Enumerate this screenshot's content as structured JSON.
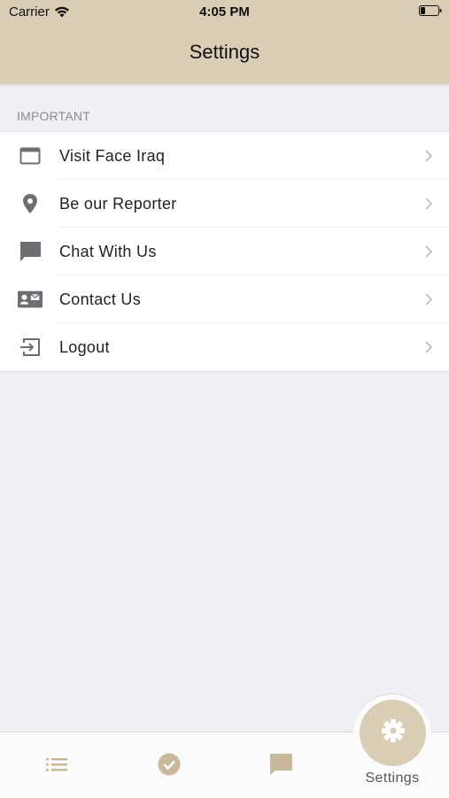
{
  "status_bar": {
    "carrier": "Carrier",
    "time": "4:05 PM"
  },
  "header": {
    "title": "Settings"
  },
  "section": {
    "title": "IMPORTANT"
  },
  "menu": {
    "items": [
      {
        "label": "Visit Face Iraq",
        "icon": "browser-window-icon"
      },
      {
        "label": "Be our Reporter",
        "icon": "location-pin-icon"
      },
      {
        "label": "Chat With Us",
        "icon": "chat-bubble-icon"
      },
      {
        "label": "Contact Us",
        "icon": "contact-card-icon"
      },
      {
        "label": "Logout",
        "icon": "logout-icon"
      }
    ]
  },
  "tabbar": {
    "tabs": [
      {
        "icon": "list-icon"
      },
      {
        "icon": "checkmark-circle-icon"
      },
      {
        "icon": "chat-bubble-icon"
      },
      {
        "icon": "gear-icon",
        "label": "Settings",
        "selected": true
      }
    ]
  },
  "colors": {
    "accent": "#d9cdb6",
    "icon_gray": "#6d6d72",
    "tab_icon": "#c8b99d"
  }
}
